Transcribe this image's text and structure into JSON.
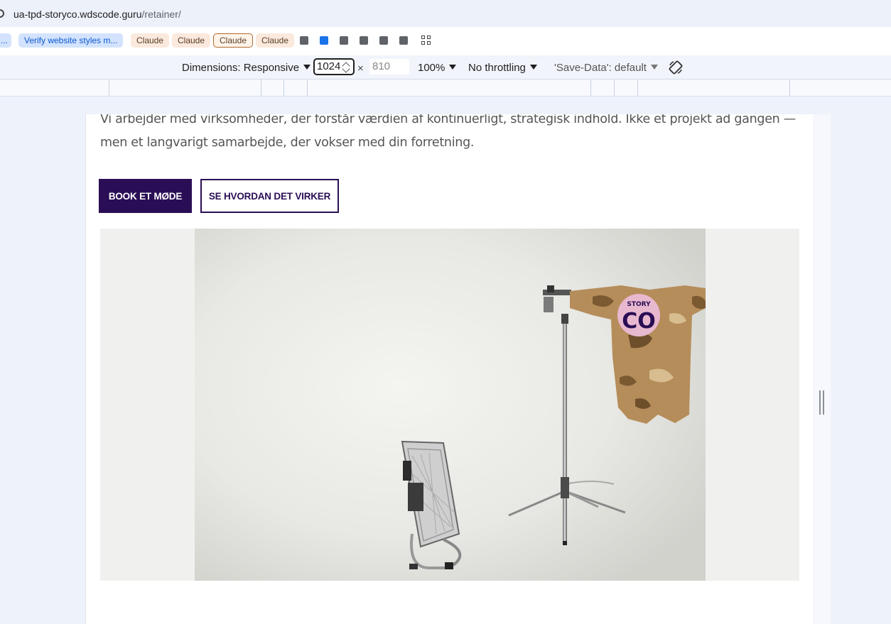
{
  "browser": {
    "url_host": "ua-tpd-storyco.wdscode.guru",
    "url_path": "/retainer/"
  },
  "bookmarks": {
    "overflow": "...",
    "items": [
      {
        "label": "Verify website styles m..."
      },
      {
        "label": "Claude"
      },
      {
        "label": "Claude"
      },
      {
        "label": "Claude"
      },
      {
        "label": "Claude"
      }
    ],
    "icons": [
      "tab-icon",
      "tab-icon-blue",
      "tab-icon",
      "tab-icon",
      "tab-icon",
      "tab-icon",
      "apps-grid-icon"
    ]
  },
  "device_toolbar": {
    "dimensions_label": "Dimensions: Responsive",
    "width_value": "1024",
    "times": "×",
    "height_placeholder": "810",
    "zoom": "100%",
    "throttling": "No throttling",
    "save_data": "'Save-Data': default",
    "rotate_icon": "rotate-icon"
  },
  "page": {
    "intro_text": "Vi arbejder med virksomheder, der forstår værdien af kontinuerligt, strategisk indhold. Ikke et projekt ad gangen — men et langvarigt samarbejde, der vokser med din forretning.",
    "primary_cta": "BOOK ET MØDE",
    "secondary_cta": "SE HVORDAN DET VIRKER",
    "badge_top": "STORY",
    "badge_bottom": "CO"
  },
  "colors": {
    "brand_purple": "#2a0e55",
    "badge_pink": "#e8b8cf",
    "camo": "#b58d5a"
  }
}
